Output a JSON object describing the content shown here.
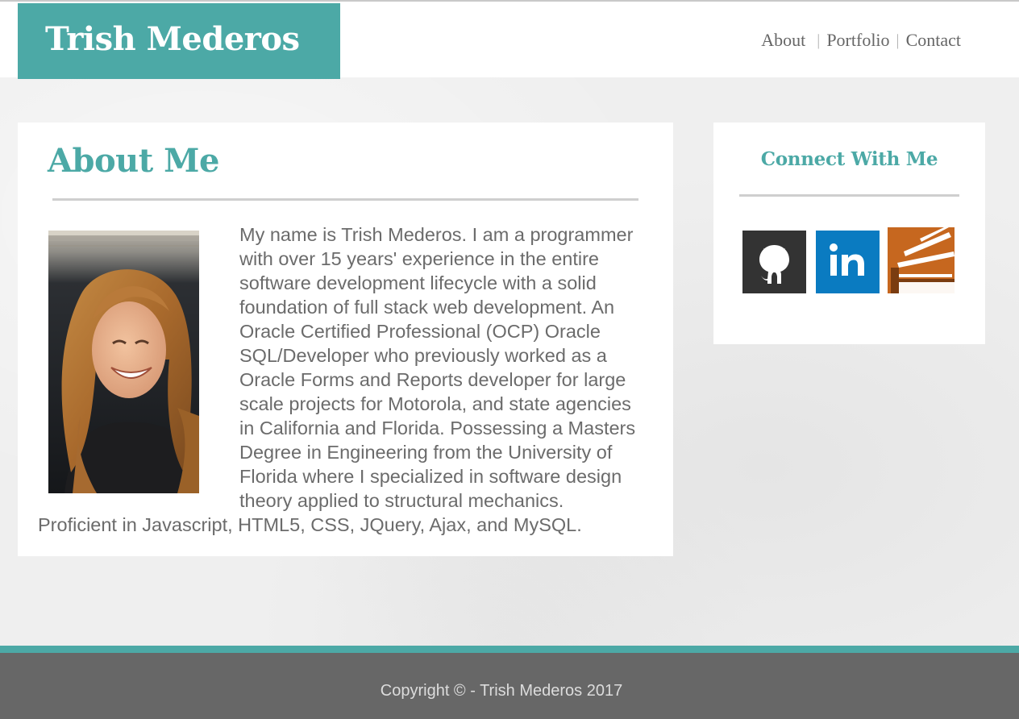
{
  "header": {
    "brand": "Trish Mederos",
    "nav": {
      "about": "About",
      "portfolio": "Portfolio",
      "contact": "Contact",
      "separator": "|"
    }
  },
  "about": {
    "title": "About Me",
    "bio": "My name is Trish Mederos. I am a programmer with over 15 years' experience in the entire software development lifecycle with a solid foundation of full stack web development. An Oracle Certified Professional (OCP) Oracle SQL/Developer who previously worked as a Oracle Forms and Reports developer for large scale projects for Motorola, and state agencies in California and Florida. Possessing a Masters Degree in Engineering from the University of Florida where I specialized in software design theory applied to structural mechanics. Proficient in Javascript, HTML5, CSS, JQuery, Ajax, and MySQL."
  },
  "connect": {
    "title": "Connect With Me",
    "links": [
      {
        "icon": "github-icon",
        "color": "#333333"
      },
      {
        "icon": "linkedin-icon",
        "color": "#0a7bc1"
      },
      {
        "icon": "stackoverflow-icon",
        "color": "#c6671f"
      }
    ]
  },
  "footer": {
    "copyright": "Copyright © - Trish Mederos 2017"
  },
  "colors": {
    "accent": "#4ca9a6",
    "footer_bg": "#676767",
    "text": "#6b6b6b"
  }
}
